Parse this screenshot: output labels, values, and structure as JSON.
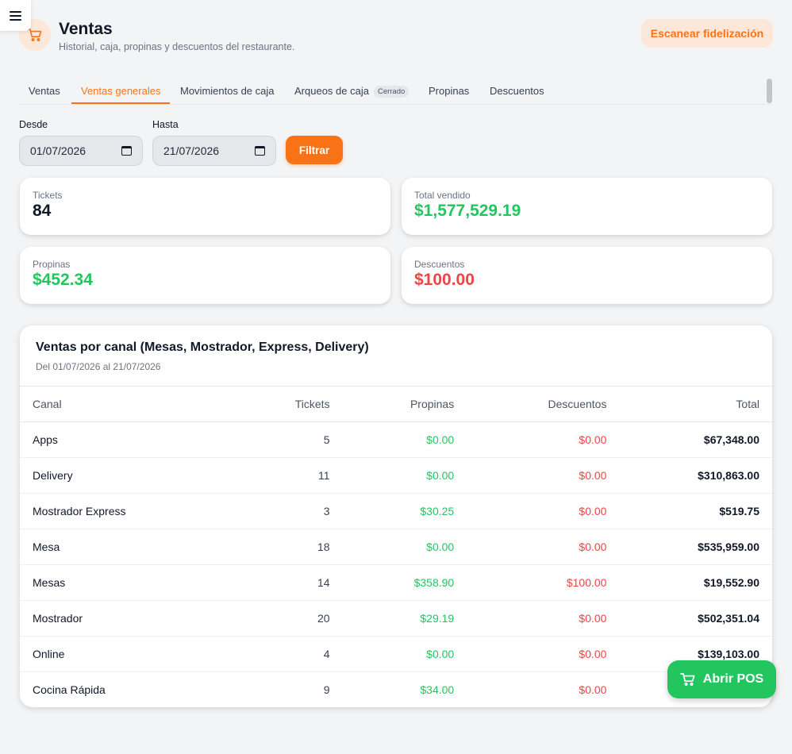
{
  "header": {
    "title": "Ventas",
    "subtitle": "Historial, caja, propinas y descuentos del restaurante.",
    "icon": "cart-icon",
    "scan_button": "Escanear fidelización"
  },
  "tabs": [
    {
      "label": "Ventas",
      "active": false
    },
    {
      "label": "Ventas generales",
      "active": true
    },
    {
      "label": "Movimientos de caja",
      "active": false
    },
    {
      "label": "Arqueos de caja",
      "active": false,
      "badge": "Cerrado"
    },
    {
      "label": "Propinas",
      "active": false
    },
    {
      "label": "Descuentos",
      "active": false
    }
  ],
  "filters": {
    "from_label": "Desde",
    "from_value": "01/07/2026",
    "to_label": "Hasta",
    "to_value": "21/07/2026",
    "filter_button": "Filtrar"
  },
  "stats": {
    "tickets": {
      "label": "Tickets",
      "value": "84"
    },
    "total": {
      "label": "Total vendido",
      "value": "$1,577,529.19"
    },
    "tips": {
      "label": "Propinas",
      "value": "$452.34"
    },
    "discounts": {
      "label": "Descuentos",
      "value": "$100.00"
    }
  },
  "channel_table": {
    "title": "Ventas por canal (Mesas, Mostrador, Express, Delivery)",
    "subtitle": "Del 01/07/2026 al 21/07/2026",
    "headers": {
      "canal": "Canal",
      "tickets": "Tickets",
      "propinas": "Propinas",
      "descuentos": "Descuentos",
      "total": "Total"
    },
    "rows": [
      {
        "canal": "Apps",
        "tickets": "5",
        "propinas": "$0.00",
        "descuentos": "$0.00",
        "total": "$67,348.00"
      },
      {
        "canal": "Delivery",
        "tickets": "11",
        "propinas": "$0.00",
        "descuentos": "$0.00",
        "total": "$310,863.00"
      },
      {
        "canal": "Mostrador Express",
        "tickets": "3",
        "propinas": "$30.25",
        "descuentos": "$0.00",
        "total": "$519.75"
      },
      {
        "canal": "Mesa",
        "tickets": "18",
        "propinas": "$0.00",
        "descuentos": "$0.00",
        "total": "$535,959.00"
      },
      {
        "canal": "Mesas",
        "tickets": "14",
        "propinas": "$358.90",
        "descuentos": "$100.00",
        "total": "$19,552.90"
      },
      {
        "canal": "Mostrador",
        "tickets": "20",
        "propinas": "$29.19",
        "descuentos": "$0.00",
        "total": "$502,351.04"
      },
      {
        "canal": "Online",
        "tickets": "4",
        "propinas": "$0.00",
        "descuentos": "$0.00",
        "total": "$139,103.00"
      },
      {
        "canal": "Cocina Rápida",
        "tickets": "9",
        "propinas": "$34.00",
        "descuentos": "$0.00",
        "total": ""
      }
    ]
  },
  "pos_button": {
    "label": "Abrir POS",
    "icon": "cart-icon"
  },
  "colors": {
    "accent": "#f97316",
    "positive": "#22c55e",
    "negative": "#ef4444"
  }
}
